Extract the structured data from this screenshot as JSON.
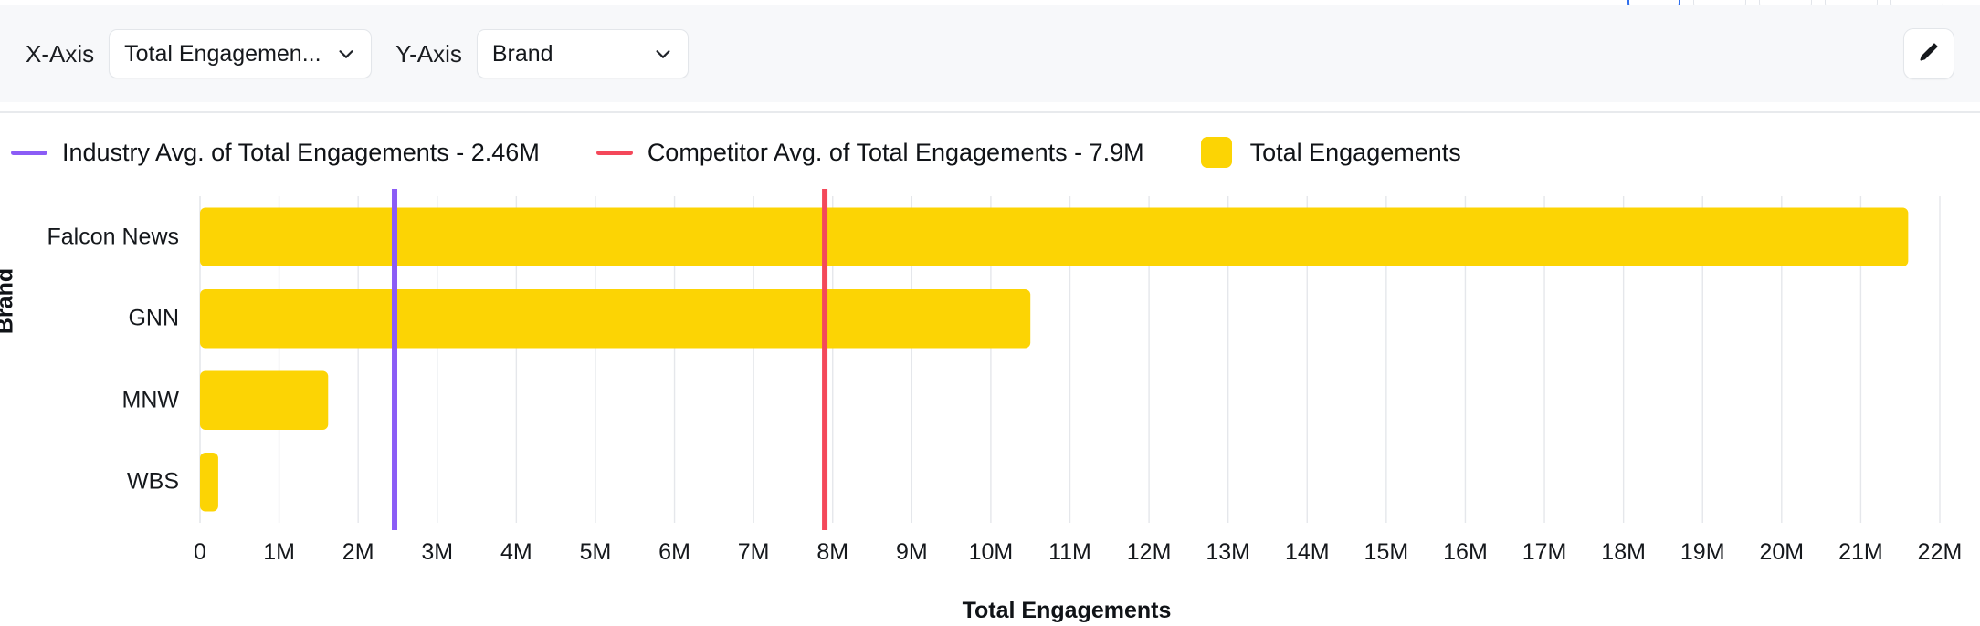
{
  "toolbar": {
    "x_axis_label": "X-Axis",
    "x_axis_value": "Total Engagemen...",
    "y_axis_label": "Y-Axis",
    "y_axis_value": "Brand",
    "edit_icon": "pencil-icon",
    "chevron_icon": "chevron-down-icon"
  },
  "top_buttons": [
    {
      "label": "",
      "active": true
    },
    {
      "label": "",
      "active": false
    },
    {
      "label": "",
      "active": false
    },
    {
      "label": "",
      "active": false
    },
    {
      "label": "",
      "active": false
    }
  ],
  "legend": [
    {
      "label": "Industry Avg. of Total Engagements - 2.46M",
      "color": "#8B5CF6",
      "marker": "line"
    },
    {
      "label": "Competitor Avg. of Total Engagements - 7.9M",
      "color": "#F4485A",
      "marker": "line"
    },
    {
      "label": "Total Engagements",
      "color": "#FCD404",
      "marker": "swatch"
    }
  ],
  "chart_data": {
    "type": "bar",
    "orientation": "horizontal",
    "title": "",
    "xlabel": "Total Engagements",
    "ylabel": "Brand",
    "categories": [
      "Falcon News",
      "GNN",
      "MNW",
      "WBS"
    ],
    "values": [
      21600000,
      10500000,
      1620000,
      230000
    ],
    "series": [
      {
        "name": "Total Engagements",
        "color": "#FCD404",
        "values": [
          21600000,
          10500000,
          1620000,
          230000
        ]
      }
    ],
    "xlim": [
      0,
      22000000
    ],
    "xticks": [
      "0",
      "1M",
      "2M",
      "3M",
      "4M",
      "5M",
      "6M",
      "7M",
      "8M",
      "9M",
      "10M",
      "11M",
      "12M",
      "13M",
      "14M",
      "15M",
      "16M",
      "17M",
      "18M",
      "19M",
      "20M",
      "21M",
      "22M"
    ],
    "xtick_values": [
      0,
      1000000,
      2000000,
      3000000,
      4000000,
      5000000,
      6000000,
      7000000,
      8000000,
      9000000,
      10000000,
      11000000,
      12000000,
      13000000,
      14000000,
      15000000,
      16000000,
      17000000,
      18000000,
      19000000,
      20000000,
      21000000,
      22000000
    ],
    "grid": true,
    "grid_color": "#E5E7EB",
    "legend_position": "top-left",
    "reference_lines": [
      {
        "name": "Industry Avg. of Total Engagements",
        "value": 2460000,
        "display": "2.46M",
        "color": "#8B5CF6"
      },
      {
        "name": "Competitor Avg. of Total Engagements",
        "value": 7900000,
        "display": "7.9M",
        "color": "#F4485A"
      }
    ]
  }
}
